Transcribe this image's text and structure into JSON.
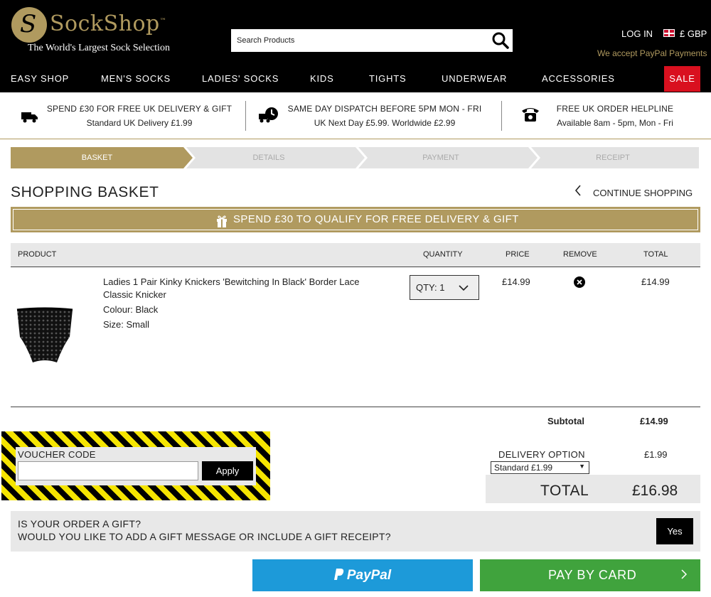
{
  "brand": {
    "name": "SockShop",
    "trademark": "™",
    "tagline": "The World's Largest Sock Selection",
    "primary_color": "#b09a5f"
  },
  "header": {
    "search_placeholder": "Search Products",
    "login": "LOG IN",
    "currency": "£ GBP",
    "paypal_note": "We accept PayPal Payments"
  },
  "nav": {
    "items": [
      "EASY SHOP",
      "MEN'S SOCKS",
      "LADIES' SOCKS",
      "KIDS",
      "TIGHTS",
      "UNDERWEAR",
      "ACCESSORIES"
    ],
    "sale": "SALE",
    "sale_color": "#d9101f"
  },
  "info": [
    {
      "line1": "SPEND £30 FOR FREE UK DELIVERY & GIFT",
      "line2": "Standard UK Delivery £1.99",
      "icon": "delivery-truck-icon"
    },
    {
      "line1": "SAME DAY DISPATCH BEFORE 5PM MON - FRI",
      "line2": "UK Next Day £5.99. Worldwide £2.99",
      "icon": "fast-dispatch-icon"
    },
    {
      "line1": "FREE UK ORDER HELPLINE",
      "line2": "Available 8am - 5pm, Mon - Fri",
      "icon": "telephone-icon"
    }
  ],
  "steps": [
    "BASKET",
    "DETAILS",
    "PAYMENT",
    "RECEIPT"
  ],
  "page": {
    "title": "SHOPPING BASKET",
    "continue": "CONTINUE SHOPPING",
    "gift_banner": "SPEND £30 TO QUALIFY FOR FREE DELIVERY & GIFT"
  },
  "table": {
    "headers": {
      "product": "PRODUCT",
      "quantity": "QUANTITY",
      "price": "PRICE",
      "remove": "REMOVE",
      "total": "TOTAL"
    },
    "item": {
      "name": "Ladies 1 Pair Kinky Knickers 'Bewitching In Black' Border Lace Classic Knicker",
      "colour": "Colour: Black",
      "size": "Size: Small",
      "qty": "QTY: 1",
      "price": "£14.99",
      "total": "£14.99"
    }
  },
  "summary": {
    "subtotal_label": "Subtotal",
    "subtotal_value": "£14.99",
    "delivery_label": "DELIVERY OPTION",
    "delivery_value": "£1.99",
    "delivery_selected": "Standard £1.99",
    "total_label": "TOTAL",
    "total_value": "£16.98"
  },
  "voucher": {
    "label": "VOUCHER CODE",
    "value": "",
    "apply": "Apply"
  },
  "gift": {
    "question1": "IS YOUR ORDER A GIFT?",
    "question2": "WOULD YOU LIKE TO ADD A GIFT MESSAGE OR INCLUDE A GIFT RECEIPT?",
    "yes": "Yes"
  },
  "actions": {
    "paypal": "PayPal",
    "paypal_color": "#1d9ad9",
    "card": "PAY BY CARD",
    "card_color": "#40a33d"
  }
}
